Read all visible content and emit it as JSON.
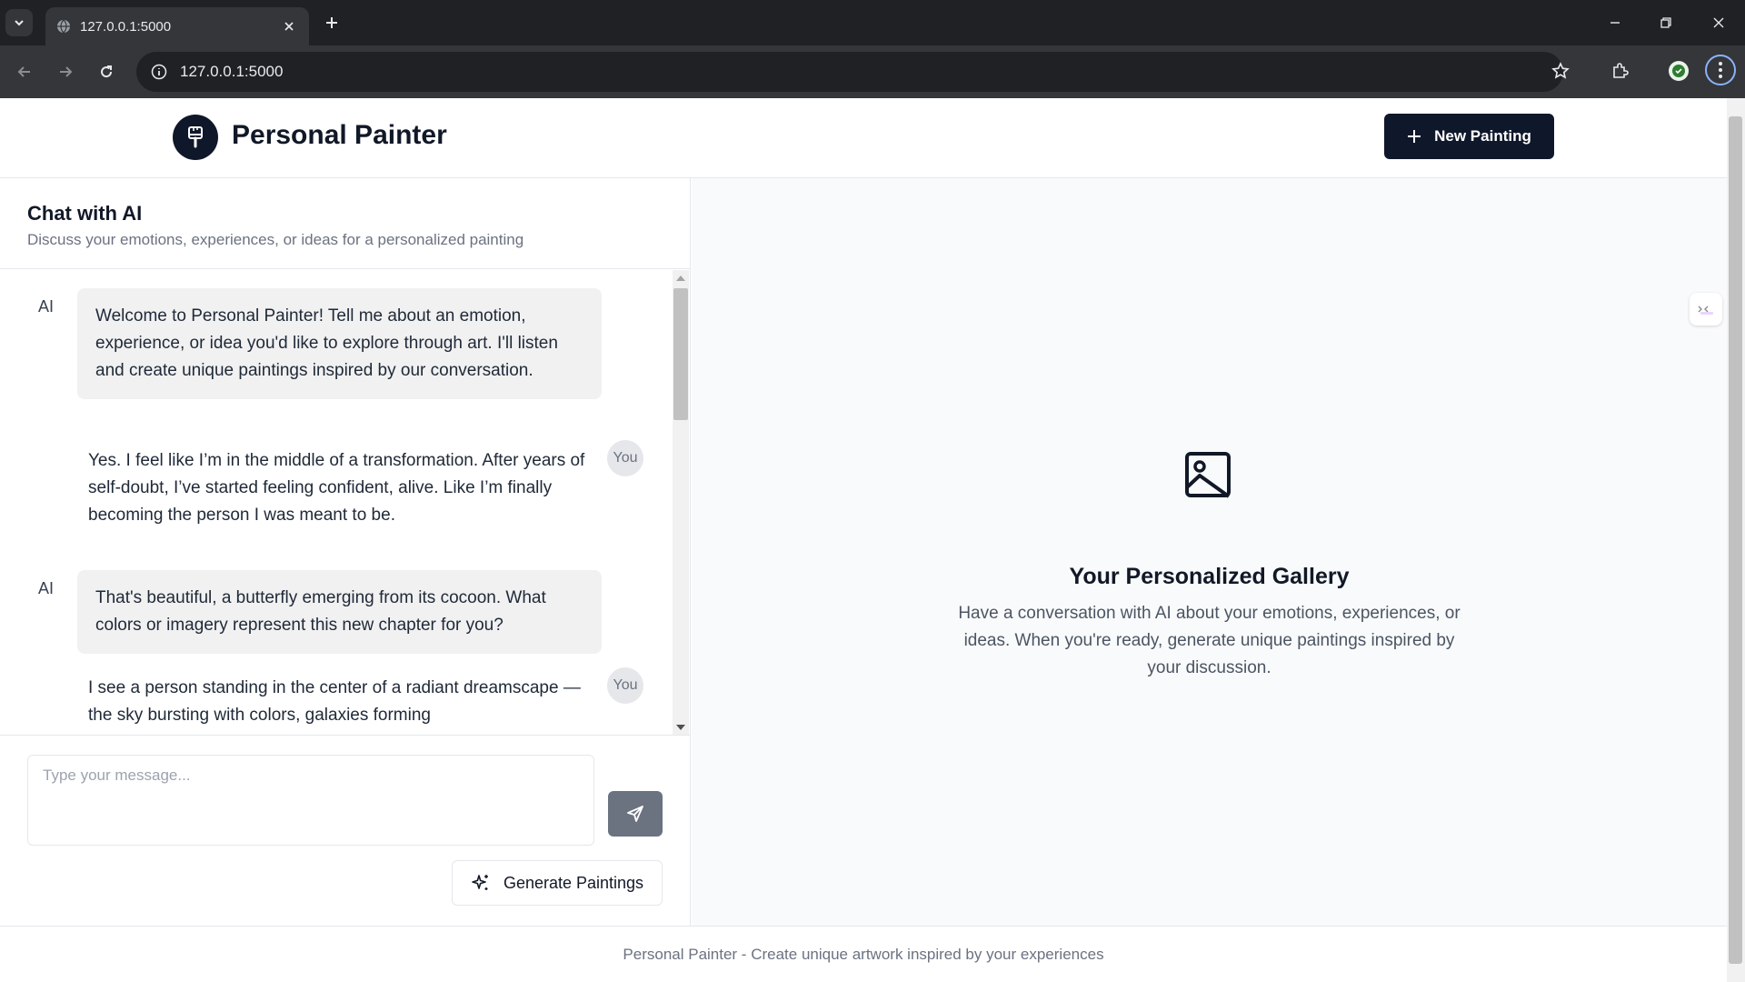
{
  "browser": {
    "tab_title": "127.0.0.1:5000",
    "url": "127.0.0.1:5000"
  },
  "header": {
    "app_title": "Personal Painter",
    "new_painting_label": "New Painting"
  },
  "chat": {
    "title": "Chat with AI",
    "subtitle": "Discuss your emotions, experiences, or ideas for a personalized painting",
    "ai_label": "AI",
    "you_label": "You",
    "messages": [
      {
        "role": "ai",
        "text": "Welcome to Personal Painter! Tell me about an emotion, experience, or idea you'd like to explore through art. I'll listen and create unique paintings inspired by our conversation."
      },
      {
        "role": "user",
        "text": "Yes. I feel like I’m in the middle of a transformation. After years of self-doubt, I’ve started feeling confident, alive. Like I’m finally becoming the person I was meant to be."
      },
      {
        "role": "ai",
        "text": "That's beautiful, a butterfly emerging from its cocoon. What colors or imagery represent this new chapter for you?"
      },
      {
        "role": "user",
        "text": "I see a person standing in the center of a radiant dreamscape — the sky bursting with colors, galaxies forming"
      }
    ],
    "input_placeholder": "Type your message...",
    "generate_label": "Generate Paintings"
  },
  "gallery": {
    "title": "Your Personalized Gallery",
    "description": "Have a conversation with AI about your emotions, experiences, or ideas. When you're ready, generate unique paintings inspired by your discussion."
  },
  "footer": {
    "text": "Personal Painter - Create unique artwork inspired by your experiences"
  },
  "colors": {
    "primary": "#0f172a",
    "bubble_ai": "#f1f1f2",
    "gallery_bg": "#f9fafb",
    "send_button": "#6b7280"
  }
}
